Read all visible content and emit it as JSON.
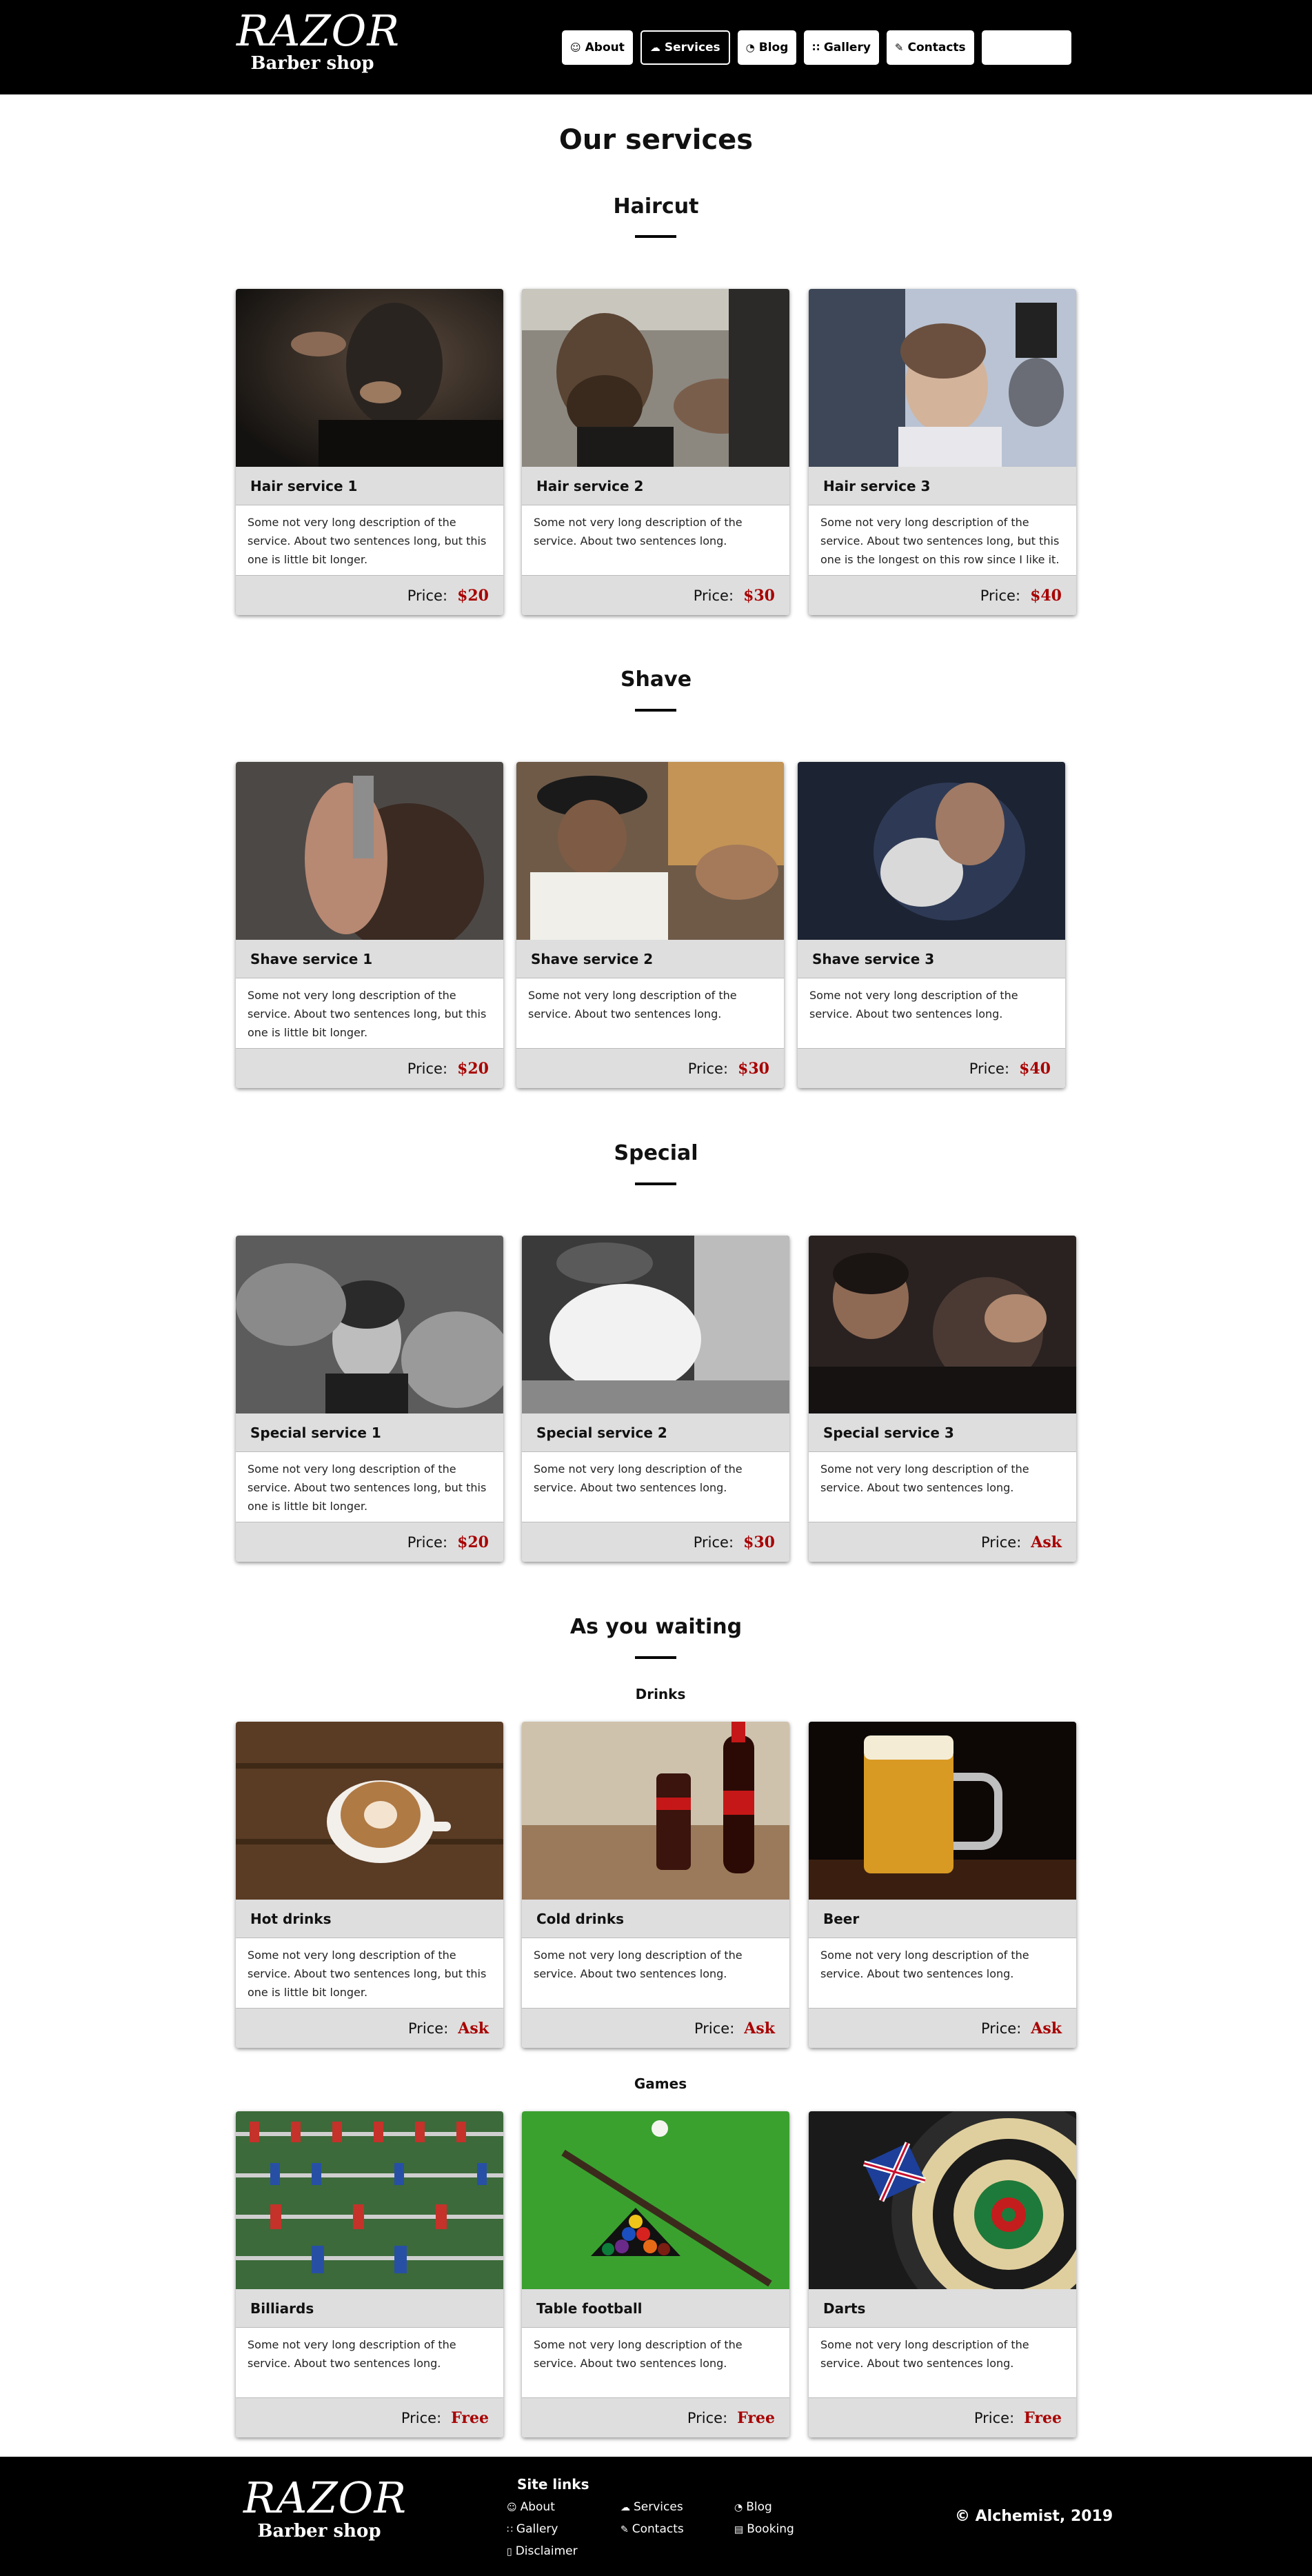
{
  "header": {
    "logo_title": "RAZOR",
    "logo_subtitle": "Barber shop",
    "nav": [
      {
        "icon": "user-icon",
        "glyph": "☺",
        "label": "About"
      },
      {
        "icon": "cloud-icon",
        "glyph": "☁",
        "label": "Services",
        "active": true
      },
      {
        "icon": "rss-icon",
        "glyph": "◔",
        "label": "Blog"
      },
      {
        "icon": "grid-icon",
        "glyph": "∷",
        "label": "Gallery"
      },
      {
        "icon": "edit-icon",
        "glyph": "✎",
        "label": "Contacts"
      }
    ]
  },
  "page_title": "Our services",
  "sections": {
    "haircut": {
      "title": "Haircut",
      "cards": [
        {
          "name": "Hair service 1",
          "desc": "Some not very long description of the service. About two sentences long, but this one is little bit longer.",
          "price_label": "Price:",
          "price": "$20"
        },
        {
          "name": "Hair service 2",
          "desc": "Some not very long description of the service. About two sentences long.",
          "price_label": "Price:",
          "price": "$30"
        },
        {
          "name": "Hair service 3",
          "desc": "Some not very long description of the service. About two sentences long, but this one is the longest on this row since I like it.",
          "price_label": "Price:",
          "price": "$40"
        }
      ]
    },
    "shave": {
      "title": "Shave",
      "cards": [
        {
          "name": "Shave service 1",
          "desc": "Some not very long description of the service. About two sentences long, but this one is little bit longer.",
          "price_label": "Price:",
          "price": "$20"
        },
        {
          "name": "Shave service 2",
          "desc": "Some not very long description of the service. About two sentences long.",
          "price_label": "Price:",
          "price": "$30"
        },
        {
          "name": "Shave service 3",
          "desc": "Some not very long description of the service. About two sentences long.",
          "price_label": "Price:",
          "price": "$40"
        }
      ]
    },
    "special": {
      "title": "Special",
      "cards": [
        {
          "name": "Special service 1",
          "desc": "Some not very long description of the service. About two sentences long, but this one is little bit longer.",
          "price_label": "Price:",
          "price": "$20"
        },
        {
          "name": "Special service 2",
          "desc": "Some not very long description of the service. About two sentences long.",
          "price_label": "Price:",
          "price": "$30"
        },
        {
          "name": "Special service 3",
          "desc": "Some not very long description of the service. About two sentences long.",
          "price_label": "Price:",
          "price": "Ask"
        }
      ]
    },
    "waiting": {
      "title": "As you waiting",
      "drinks_title": "Drinks",
      "drinks": [
        {
          "name": "Hot drinks",
          "desc": "Some not very long description of the service. About two sentences long, but this one is little bit longer.",
          "price_label": "Price:",
          "price": "Ask"
        },
        {
          "name": "Cold drinks",
          "desc": "Some not very long description of the service. About two sentences long.",
          "price_label": "Price:",
          "price": "Ask"
        },
        {
          "name": "Beer",
          "desc": "Some not very long description of the service. About two sentences long.",
          "price_label": "Price:",
          "price": "Ask"
        }
      ],
      "games_title": "Games",
      "games": [
        {
          "name": "Billiards",
          "desc": "Some not very long description of the service. About two sentences long.",
          "price_label": "Price:",
          "price": "Free"
        },
        {
          "name": "Table football",
          "desc": "Some not very long description of the service. About two sentences long.",
          "price_label": "Price:",
          "price": "Free"
        },
        {
          "name": "Darts",
          "desc": "Some not very long description of the service. About two sentences long.",
          "price_label": "Price:",
          "price": "Free"
        }
      ]
    }
  },
  "footer": {
    "logo_title": "RAZOR",
    "logo_subtitle": "Barber shop",
    "links_heading": "Site links",
    "links": {
      "about": "About",
      "services": "Services",
      "blog": "Blog",
      "gallery": "Gallery",
      "contacts": "Contacts",
      "booking": "Booking",
      "disclaimer": "Disclaimer"
    },
    "copyright": "© Alchemist, 2019"
  },
  "colors": {
    "price": "#a80000",
    "header_bg": "#000000",
    "card_band": "#dedede"
  }
}
